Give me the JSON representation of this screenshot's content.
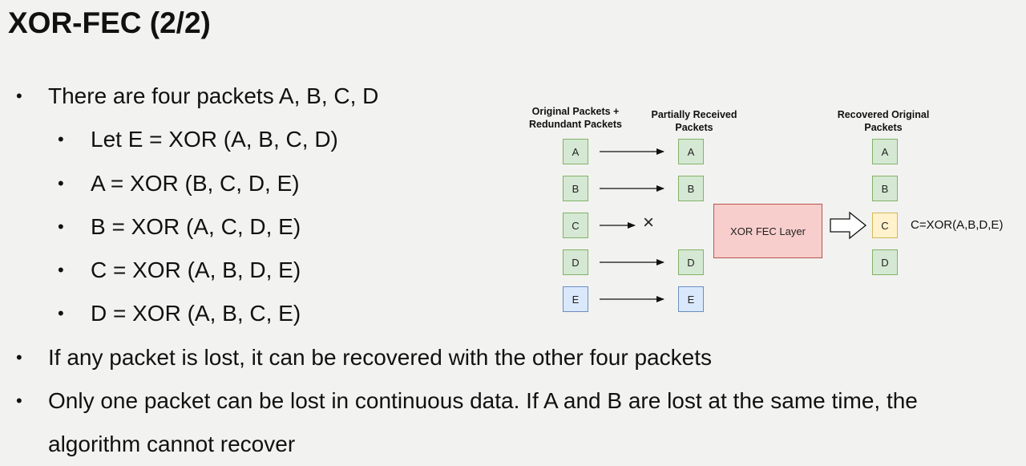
{
  "title": "XOR-FEC (2/2)",
  "bullets": [
    {
      "level": 1,
      "text": "There are four packets A, B, C, D"
    },
    {
      "level": 2,
      "text": "Let E = XOR (A, B, C, D)"
    },
    {
      "level": 2,
      "text": "A = XOR (B, C, D, E)"
    },
    {
      "level": 2,
      "text": "B = XOR (A, C, D, E)"
    },
    {
      "level": 2,
      "text": "C = XOR (A, B, D, E)"
    },
    {
      "level": 2,
      "text": "D = XOR (A, B, C, E)"
    },
    {
      "level": 1,
      "text": "If any packet is lost, it can be recovered with the other four packets"
    },
    {
      "level": 1,
      "text": "Only one packet can be lost in continuous data. If A and B are lost at the same time, the algorithm cannot recover"
    }
  ],
  "bullet_symbol": "•",
  "diagram": {
    "col1_label": "Original Packets + Redundant Packets",
    "col2_label": "Partially Received Packets",
    "col3_label": "Recovered Original Packets",
    "original": [
      "A",
      "B",
      "C",
      "D",
      "E"
    ],
    "received": [
      "A",
      "B",
      "D",
      "E"
    ],
    "recovered": [
      "A",
      "B",
      "C",
      "D"
    ],
    "lost_marker": "×",
    "fec_layer": "XOR FEC Layer",
    "formula": "C=XOR(A,B,D,E)",
    "colors": {
      "green_fill": "#d5e8d4",
      "green_border": "#82b366",
      "blue_fill": "#dae8fc",
      "blue_border": "#6c8ebf",
      "yellow_fill": "#fff2cc",
      "yellow_border": "#d6b656",
      "red_fill": "#f8cecc",
      "red_border": "#b85450"
    }
  }
}
